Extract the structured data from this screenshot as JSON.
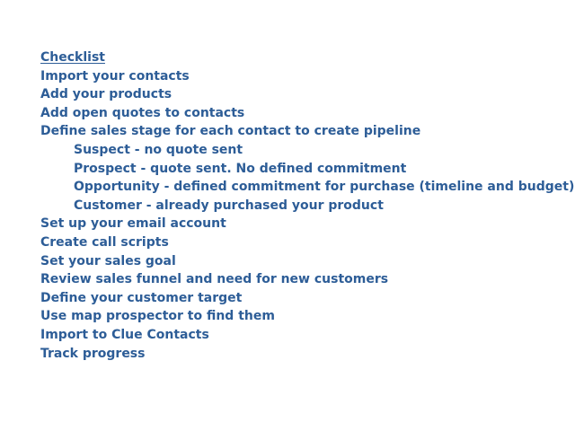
{
  "colors": {
    "text": "#2d5d97",
    "background": "#ffffff"
  },
  "checklist": {
    "title": "Checklist",
    "items": [
      {
        "text": "Import your contacts",
        "indent": 0
      },
      {
        "text": "Add your products",
        "indent": 0
      },
      {
        "text": "Add open quotes to contacts",
        "indent": 0
      },
      {
        "text": "Define sales stage for each contact to create pipeline",
        "indent": 0
      },
      {
        "text": "Suspect - no quote sent",
        "indent": 1
      },
      {
        "text": "Prospect - quote sent. No defined commitment",
        "indent": 1
      },
      {
        "text": "Opportunity - defined commitment for purchase (timeline and budget)",
        "indent": 1
      },
      {
        "text": "Customer - already purchased your product",
        "indent": 1
      },
      {
        "text": "Set up your email account",
        "indent": 0
      },
      {
        "text": "Create call scripts",
        "indent": 0
      },
      {
        "text": "Set your sales goal",
        "indent": 0
      },
      {
        "text": "Review sales funnel and need for new customers",
        "indent": 0
      },
      {
        "text": "Define your customer target",
        "indent": 0
      },
      {
        "text": "Use map prospector to find them",
        "indent": 0
      },
      {
        "text": "Import to Clue Contacts",
        "indent": 0
      },
      {
        "text": "Track progress",
        "indent": 0
      }
    ]
  }
}
